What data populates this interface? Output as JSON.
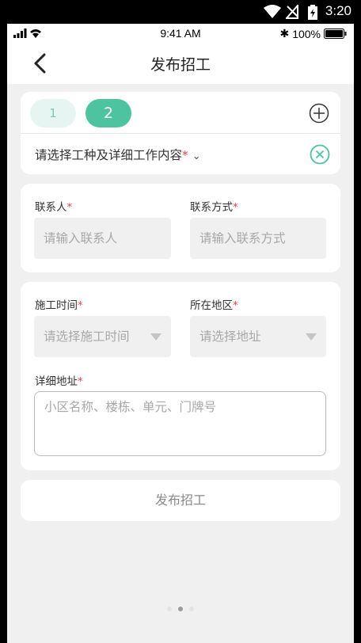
{
  "android_status": {
    "time": "3:20"
  },
  "ios_status": {
    "time": "9:41 AM",
    "battery": "100%"
  },
  "nav": {
    "title": "发布招工"
  },
  "work_card": {
    "tabs": [
      "1",
      "2"
    ],
    "active_tab": 1,
    "work_type_placeholder": "请选择工种及详细工作内容",
    "required_mark": "*",
    "dropdown_caret": "⌄"
  },
  "contact_card": {
    "contact_label": "联系人",
    "contact_placeholder": "请输入联系人",
    "method_label": "联系方式",
    "method_placeholder": "请输入联系方式"
  },
  "time_card": {
    "time_label": "施工时间",
    "time_placeholder": "请选择施工时间",
    "region_label": "所在地区",
    "region_placeholder": "请选择地址",
    "address_label": "详细地址",
    "address_placeholder": "小区名称、楼栋、单元、门牌号"
  },
  "submit_label": "发布招工",
  "required_mark": "*",
  "colors": {
    "accent": "#4ec39f",
    "accent_light": "#e6f5f1",
    "required": "#e04848"
  },
  "pager": {
    "total": 3,
    "active": 1
  }
}
